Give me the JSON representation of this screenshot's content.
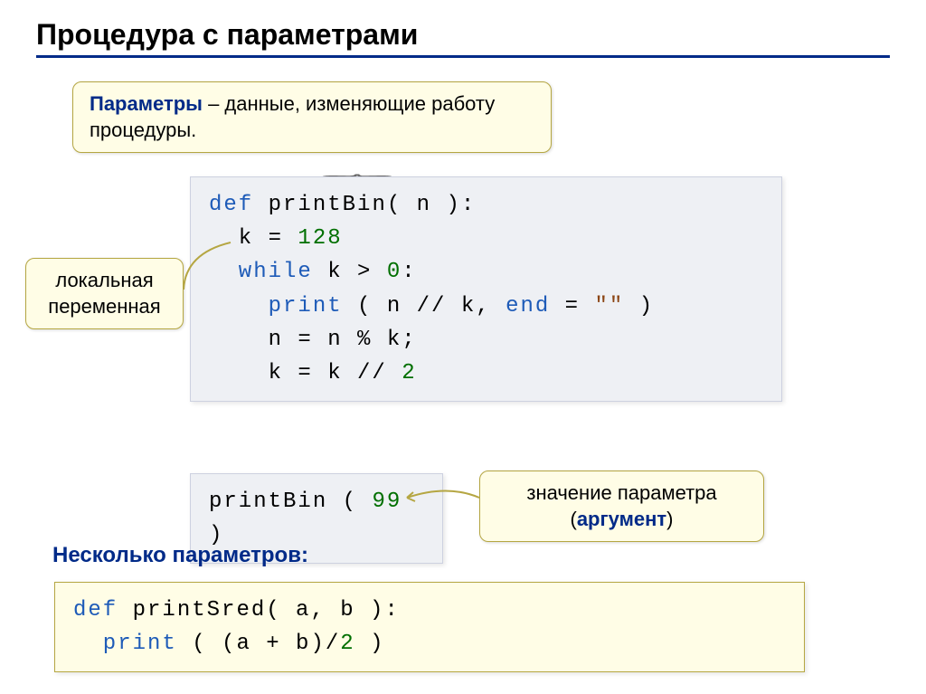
{
  "title": "Процедура с параметрами",
  "callout_top": {
    "term": "Параметры",
    "rest": " – данные, изменяющие работу процедуры."
  },
  "callout_local": "локальная переменная",
  "callout_arg": {
    "line1": "значение параметра",
    "line2_open": "(",
    "line2_word": "аргумент",
    "line2_close": ")"
  },
  "code_main": {
    "l1_def": "def",
    "l1_name": " printBin( n ):",
    "l2_pre": "  k = ",
    "l2_val": "128",
    "l3_while": "  while",
    "l3_rest": " k > ",
    "l3_zero": "0",
    "l3_colon": ":",
    "l4_print": "    print",
    "l4_rest": " ( n // k, ",
    "l4_end": "end",
    "l4_eq": " = ",
    "l4_str": "\"\"",
    "l4_close": " )",
    "l5": "    n = n % k;",
    "l6_pre": "    k = k // ",
    "l6_two": "2"
  },
  "code_call": {
    "name": "printBin ( ",
    "val": "99",
    "close": " )"
  },
  "subtitle": "Несколько параметров:",
  "code_sred": {
    "l1_def": "def",
    "l1_name": " printSred( a, b ):",
    "l2_print": "  print",
    "l2_rest": " ( (a + b)/",
    "l2_two": "2",
    "l2_close": " )"
  }
}
